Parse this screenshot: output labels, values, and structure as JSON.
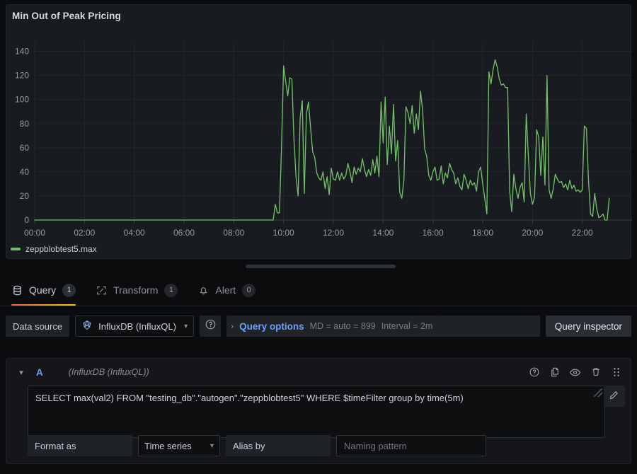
{
  "panel": {
    "title": "Min Out of Peak Pricing",
    "legend": [
      {
        "label": "zeppblobtest5.max",
        "color": "#73bf69"
      }
    ]
  },
  "chart_data": {
    "type": "line",
    "title": "Min Out of Peak Pricing",
    "xlabel": "",
    "ylabel": "",
    "grid": true,
    "legend_position": "bottom-left",
    "line_color": "#73bf69",
    "ylim": [
      0,
      148
    ],
    "yticks": [
      0,
      20,
      40,
      60,
      80,
      100,
      120,
      140
    ],
    "xlim": [
      "00:00",
      "23:55"
    ],
    "xticks": [
      "00:00",
      "02:00",
      "04:00",
      "06:00",
      "08:00",
      "10:00",
      "12:00",
      "14:00",
      "16:00",
      "18:00",
      "20:00",
      "22:00"
    ],
    "series": [
      {
        "name": "zeppblobtest5.max",
        "color": "#73bf69",
        "x": [
          "00:00",
          "01:00",
          "02:00",
          "03:00",
          "04:00",
          "05:00",
          "06:00",
          "07:00",
          "08:00",
          "09:00",
          "09:20",
          "09:30",
          "09:35",
          "09:40",
          "09:45",
          "09:50",
          "09:55",
          "10:00",
          "10:05",
          "10:10",
          "10:15",
          "10:20",
          "10:25",
          "10:30",
          "10:35",
          "10:40",
          "10:45",
          "10:50",
          "10:55",
          "11:00",
          "11:05",
          "11:10",
          "11:15",
          "11:20",
          "11:25",
          "11:30",
          "11:35",
          "11:40",
          "11:45",
          "11:50",
          "11:55",
          "12:00",
          "12:05",
          "12:10",
          "12:15",
          "12:20",
          "12:25",
          "12:30",
          "12:35",
          "12:40",
          "12:45",
          "12:50",
          "12:55",
          "13:00",
          "13:05",
          "13:10",
          "13:15",
          "13:20",
          "13:25",
          "13:30",
          "13:35",
          "13:40",
          "13:45",
          "13:50",
          "13:55",
          "14:00",
          "14:05",
          "14:10",
          "14:15",
          "14:20",
          "14:25",
          "14:30",
          "14:35",
          "14:40",
          "14:45",
          "14:50",
          "14:55",
          "15:00",
          "15:05",
          "15:10",
          "15:15",
          "15:20",
          "15:25",
          "15:30",
          "15:35",
          "15:40",
          "15:45",
          "15:50",
          "15:55",
          "16:00",
          "16:05",
          "16:10",
          "16:15",
          "16:20",
          "16:25",
          "16:30",
          "16:35",
          "16:40",
          "16:45",
          "16:50",
          "16:55",
          "17:00",
          "17:05",
          "17:10",
          "17:15",
          "17:20",
          "17:25",
          "17:30",
          "17:35",
          "17:40",
          "17:45",
          "17:50",
          "17:55",
          "18:00",
          "18:05",
          "18:10",
          "18:15",
          "18:20",
          "18:25",
          "18:30",
          "18:35",
          "18:40",
          "18:45",
          "18:50",
          "18:55",
          "19:00",
          "19:05",
          "19:10",
          "19:15",
          "19:20",
          "19:25",
          "19:30",
          "19:35",
          "19:40",
          "19:45",
          "19:50",
          "19:55",
          "20:00",
          "20:05",
          "20:10",
          "20:15",
          "20:20",
          "20:25",
          "20:30",
          "20:35",
          "20:40",
          "20:45",
          "20:50",
          "20:55",
          "21:00",
          "21:05",
          "21:10",
          "21:15",
          "21:20",
          "21:25",
          "21:30",
          "21:35",
          "21:40",
          "21:45",
          "21:50",
          "21:55",
          "22:00",
          "22:05",
          "22:10",
          "22:15",
          "22:20",
          "22:25",
          "22:30",
          "22:35",
          "22:40",
          "22:45",
          "22:50",
          "22:55",
          "23:00",
          "23:05",
          "23:10",
          "23:15"
        ],
        "values": [
          0,
          0,
          0,
          0,
          0,
          0,
          0,
          0,
          0,
          0,
          0,
          0,
          0,
          13,
          6,
          6,
          60,
          128,
          115,
          103,
          118,
          117,
          67,
          36,
          20,
          85,
          99,
          22,
          88,
          98,
          77,
          57,
          52,
          39,
          35,
          33,
          40,
          26,
          36,
          21,
          43,
          34,
          33,
          40,
          33,
          39,
          34,
          37,
          47,
          40,
          31,
          44,
          38,
          43,
          40,
          51,
          42,
          36,
          42,
          37,
          50,
          39,
          53,
          36,
          98,
          64,
          102,
          46,
          78,
          55,
          96,
          49,
          66,
          23,
          18,
          33,
          94,
          89,
          80,
          95,
          72,
          88,
          75,
          107,
          92,
          59,
          53,
          37,
          33,
          40,
          44,
          33,
          34,
          45,
          30,
          39,
          35,
          47,
          42,
          39,
          30,
          35,
          28,
          25,
          38,
          33,
          26,
          33,
          29,
          31,
          24,
          40,
          44,
          30,
          18,
          5,
          123,
          113,
          125,
          133,
          127,
          117,
          112,
          113,
          110,
          110,
          24,
          7,
          38,
          26,
          18,
          27,
          31,
          15,
          88,
          53,
          22,
          13,
          19,
          75,
          69,
          37,
          69,
          29,
          120,
          25,
          18,
          26,
          38,
          34,
          31,
          32,
          27,
          30,
          25,
          33,
          26,
          29,
          24,
          25,
          23,
          25,
          78,
          76,
          33,
          5,
          3,
          22,
          9,
          2,
          3,
          5,
          0,
          0,
          18
        ]
      }
    ]
  },
  "tabs": [
    {
      "label": "Query",
      "count": "1",
      "icon": "database-icon",
      "active": true
    },
    {
      "label": "Transform",
      "count": "1",
      "icon": "transform-icon",
      "active": false
    },
    {
      "label": "Alert",
      "count": "0",
      "icon": "bell-icon",
      "active": false
    }
  ],
  "datasource_row": {
    "label": "Data source",
    "selected": "InfluxDB (InfluxQL)",
    "help_icon": "help-circle-icon",
    "query_options_label": "Query options",
    "max_data_points": "MD = auto = 899",
    "interval": "Interval = 2m",
    "inspector_label": "Query inspector"
  },
  "query": {
    "ref_id": "A",
    "datasource_name": "(InfluxDB (InfluxQL))",
    "sql": "SELECT max(val2) FROM \"testing_db\".\"autogen\".\"zeppblobtest5\" WHERE $timeFilter group by time(5m)",
    "actions": [
      {
        "name": "help-circle-icon"
      },
      {
        "name": "duplicate-icon"
      },
      {
        "name": "eye-icon"
      },
      {
        "name": "trash-icon"
      },
      {
        "name": "drag-handle-icon"
      }
    ],
    "edit_icon": "pencil-icon",
    "format_as_label": "Format as",
    "format_as_value": "Time series",
    "alias_by_label": "Alias by",
    "alias_placeholder": "Naming pattern",
    "alias_value": ""
  },
  "colors": {
    "accent": "#6e9fff",
    "series_green": "#73bf69",
    "tab_underline": "#f55f3e",
    "panel_bg": "#181b1f",
    "app_bg": "#0b0c0e"
  }
}
